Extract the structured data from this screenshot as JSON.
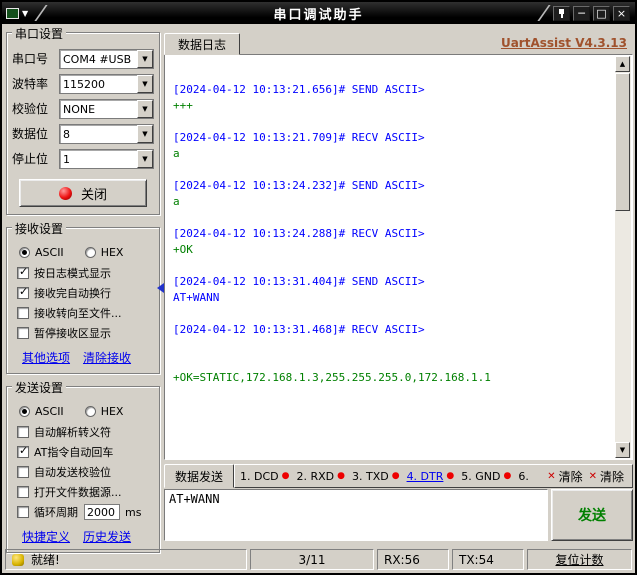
{
  "window": {
    "title": "串口调试助手"
  },
  "titlebar": {
    "min": "─",
    "max": "□",
    "close": "×"
  },
  "icons": {
    "check": "✓",
    "dropdown": "▼",
    "scroll_up": "▲",
    "scroll_down": "▼",
    "dot": "●",
    "clear": "✕"
  },
  "colors": {
    "log_header": "#0000ff",
    "recv_data": "#008000",
    "send_data": "#0000ff",
    "version_link": "#a0522d",
    "link": "#0000ee",
    "pin_on": "#ee0000",
    "send_button_text": "#008000"
  },
  "sidebar": {
    "serial": {
      "title": "串口设置",
      "fields": [
        {
          "label": "串口号",
          "value": "COM4 #USB"
        },
        {
          "label": "波特率",
          "value": "115200"
        },
        {
          "label": "校验位",
          "value": "NONE"
        },
        {
          "label": "数据位",
          "value": "8"
        },
        {
          "label": "停止位",
          "value": "1"
        }
      ],
      "close_button": "关闭"
    },
    "recv": {
      "title": "接收设置",
      "ascii": {
        "label": "ASCII",
        "selected": true
      },
      "hex": {
        "label": "HEX",
        "selected": false
      },
      "checkboxes": [
        {
          "label": "按日志模式显示",
          "checked": true
        },
        {
          "label": "接收完自动换行",
          "checked": true
        },
        {
          "label": "接收转向至文件...",
          "checked": false
        },
        {
          "label": "暂停接收区显示",
          "checked": false
        }
      ],
      "link1": "其他选项",
      "link2": "清除接收"
    },
    "send": {
      "title": "发送设置",
      "ascii": {
        "label": "ASCII",
        "selected": true
      },
      "hex": {
        "label": "HEX",
        "selected": false
      },
      "checkboxes": [
        {
          "label": "自动解析转义符",
          "checked": false
        },
        {
          "label": "AT指令自动回车",
          "checked": true
        },
        {
          "label": "自动发送校验位",
          "checked": false
        },
        {
          "label": "打开文件数据源...",
          "checked": false
        },
        {
          "label": "循环周期",
          "checked": false
        }
      ],
      "period_value": "2000",
      "period_unit": "ms",
      "link1": "快捷定义",
      "link2": "历史发送"
    }
  },
  "main": {
    "tab": "数据日志",
    "version": "UartAssist V4.3.13",
    "log": [
      {
        "header": "[2024-04-12 10:13:21.656]# SEND ASCII>",
        "data": "+++",
        "data_color": "#008000"
      },
      {
        "header": "[2024-04-12 10:13:21.709]# RECV ASCII>",
        "data": "a",
        "data_color": "#008000"
      },
      {
        "header": "[2024-04-12 10:13:24.232]# SEND ASCII>",
        "data": "a",
        "data_color": "#008000"
      },
      {
        "header": "[2024-04-12 10:13:24.288]# RECV ASCII>",
        "data": "+OK",
        "data_color": "#008000"
      },
      {
        "header": "[2024-04-12 10:13:31.404]# SEND ASCII>",
        "data": "AT+WANN",
        "data_color": "#0000ff"
      },
      {
        "header": "[2024-04-12 10:13:31.468]# RECV ASCII>",
        "data": "+OK=STATIC,172.168.1.3,255.255.255.0,172.168.1.1",
        "data_color": "#008000"
      }
    ]
  },
  "send_panel": {
    "tab": "数据发送",
    "pins": [
      {
        "label": "1. DCD",
        "dot_color": "#ee0000"
      },
      {
        "label": "2. RXD",
        "dot_color": "#ee0000"
      },
      {
        "label": "3. TXD",
        "dot_color": "#ee0000"
      },
      {
        "label": "4. DTR",
        "dot_color": "#ee0000"
      },
      {
        "label": "5. GND",
        "dot_color": "#ee0000"
      },
      {
        "label": "6."
      }
    ],
    "clear1": "清除",
    "clear2": "清除",
    "input_value": "AT+WANN",
    "send_button": "发送"
  },
  "statusbar": {
    "ready": "就绪!",
    "counter": "3/11",
    "rx": "RX:56",
    "tx": "TX:54",
    "reset": "复位计数"
  }
}
